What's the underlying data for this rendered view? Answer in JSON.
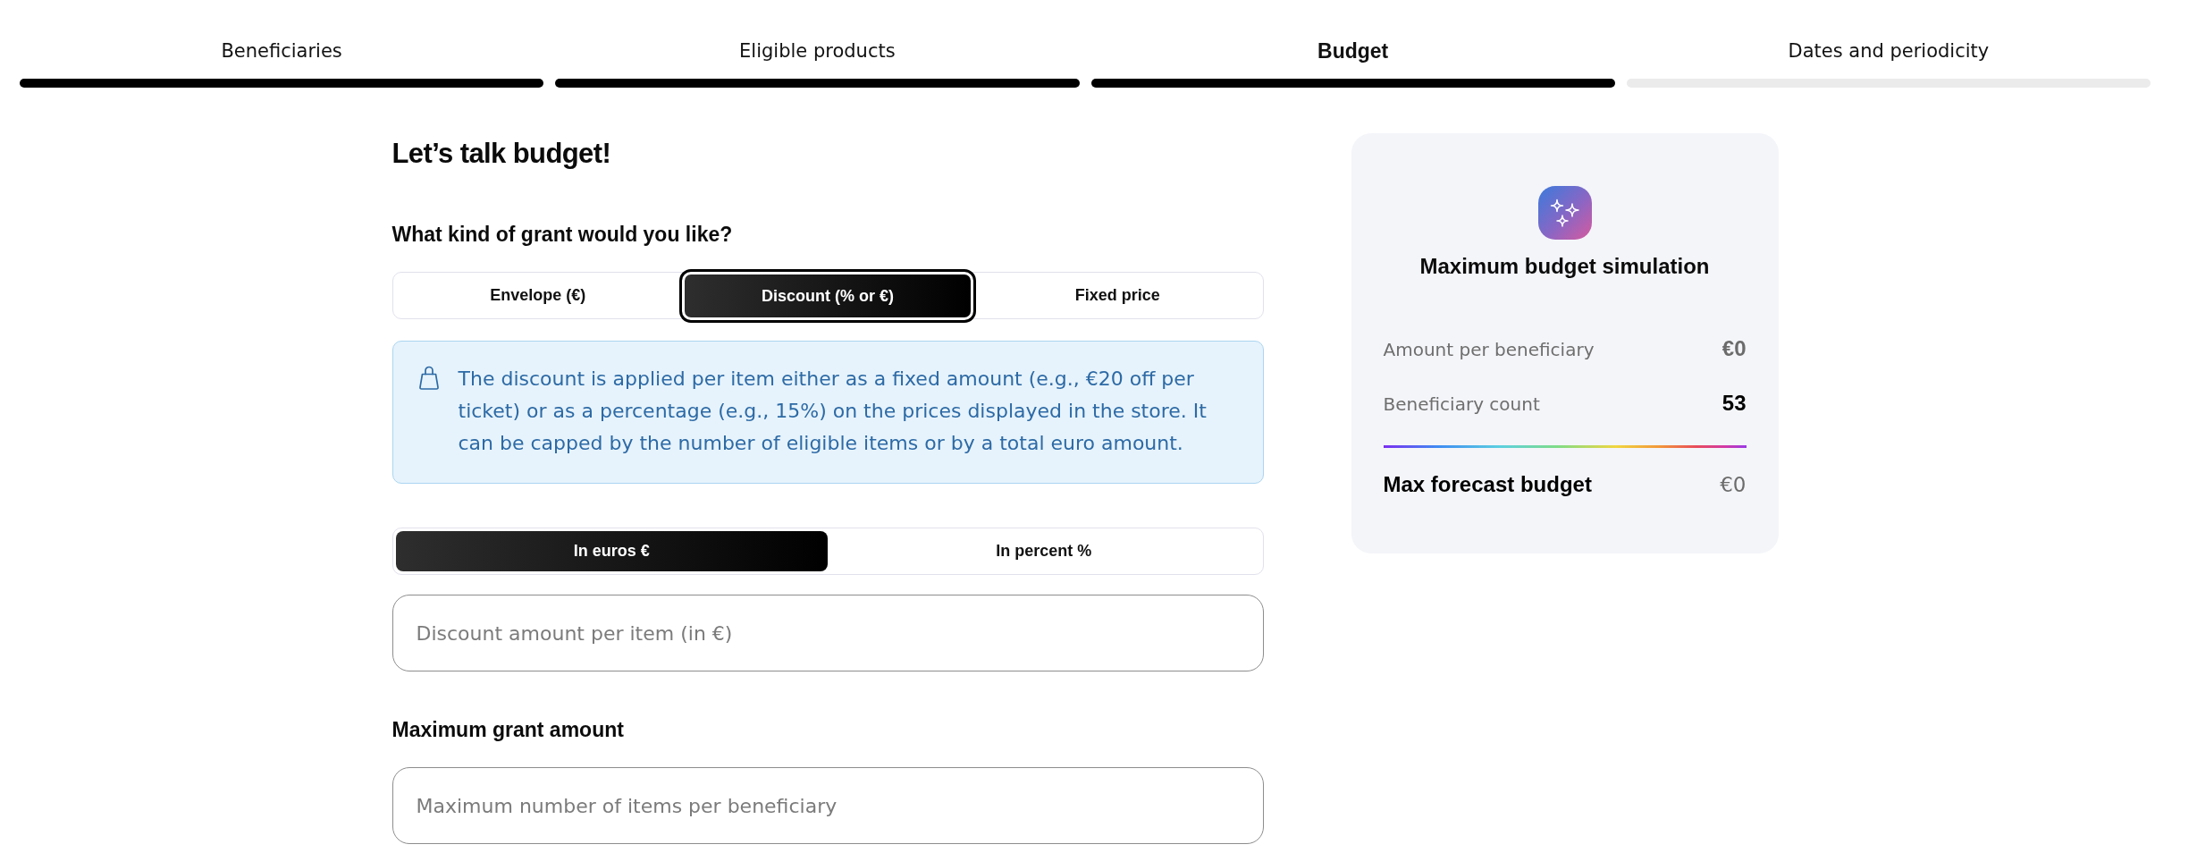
{
  "stepper": {
    "steps": [
      {
        "label": "Beneficiaries",
        "selected": false,
        "completed": true
      },
      {
        "label": "Eligible products",
        "selected": false,
        "completed": true
      },
      {
        "label": "Budget",
        "selected": true,
        "completed": true
      },
      {
        "label": "Dates and periodicity",
        "selected": false,
        "completed": false
      }
    ]
  },
  "form": {
    "title": "Let’s talk budget!",
    "grant_type": {
      "label": "What kind of grant would you like?",
      "options": [
        {
          "label": "Envelope (€)",
          "selected": false,
          "focused": false
        },
        {
          "label": "Discount (% or €)",
          "selected": true,
          "focused": true
        },
        {
          "label": "Fixed price",
          "selected": false,
          "focused": false
        }
      ]
    },
    "info": {
      "text": "The discount is applied per item either as a fixed amount (e.g., €20 off per ticket) or as a percentage (e.g., 15%) on the prices displayed in the store. It can be capped by the number of eligible items or by a total euro amount."
    },
    "unit_toggle": {
      "options": [
        {
          "label": "In euros €",
          "selected": true
        },
        {
          "label": "In percent %",
          "selected": false
        }
      ]
    },
    "discount_field": {
      "placeholder": "Discount amount per item (in €)"
    },
    "max_grant": {
      "label": "Maximum grant amount",
      "field": {
        "placeholder": "Maximum number of items per beneficiary"
      }
    }
  },
  "simulation": {
    "title": "Maximum budget simulation",
    "rows": [
      {
        "label": "Amount per beneficiary",
        "value": "€0",
        "muted": true
      },
      {
        "label": "Beneficiary count",
        "value": "53",
        "muted": false
      }
    ],
    "total": {
      "label": "Max forecast budget",
      "value": "€0",
      "muted": true
    }
  }
}
